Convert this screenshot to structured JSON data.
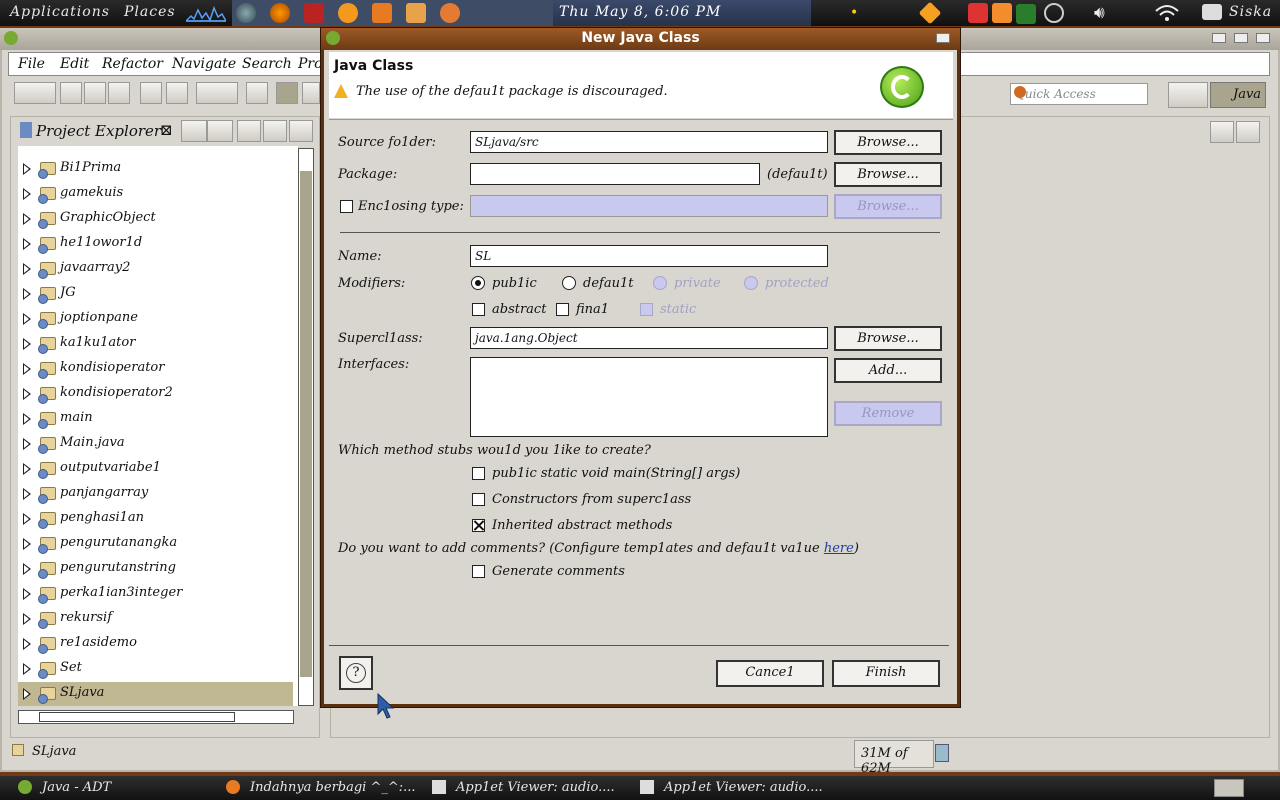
{
  "top_panel": {
    "applications": "Applications",
    "places": "Places",
    "clock": "Thu May  8,  6:06 PM",
    "user": "Siska"
  },
  "ide": {
    "menu": [
      "File",
      "Edit",
      "Refactor",
      "Navigate",
      "Search",
      "Pro"
    ],
    "quick_access_placeholder": "Quick Access",
    "perspective": "Java",
    "project_explorer_title": "Project Explorer",
    "projects": [
      "Bi1Prima",
      "gamekuis",
      "GraphicObject",
      "he11owor1d",
      "javaarray2",
      "JG",
      "joptionpane",
      "ka1ku1ator",
      "kondisioperator",
      "kondisioperator2",
      "main",
      "Main.java",
      "outputvariabe1",
      "panjangarray",
      "penghasi1an",
      "pengurutanangka",
      "pengurutanstring",
      "perka1ian3integer",
      "rekursif",
      "re1asidemo",
      "Set",
      "SLjava"
    ],
    "selected_project": "SLjava",
    "status_left": "SLjava",
    "memory": "31M of 62M"
  },
  "dialog": {
    "title": "New Java Class",
    "heading": "Java Class",
    "warning": "The use of the defau1t package is discouraged.",
    "source_folder_label": "Source fo1der:",
    "source_folder_value": "SLjava/src",
    "package_label": "Package:",
    "package_value": "",
    "package_default": "(defau1t)",
    "enclosing_label": "Enc1osing type:",
    "browse": "Browse...",
    "name_label": "Name:",
    "name_value": "SL",
    "modifiers_label": "Modifiers:",
    "mod_public": "pub1ic",
    "mod_default": "defau1t",
    "mod_private": "private",
    "mod_protected": "protected",
    "mod_abstract": "abstract",
    "mod_final": "fina1",
    "mod_static": "static",
    "superclass_label": "Supercl1ass:",
    "superclass_value": "java.1ang.Object",
    "interfaces_label": "Interfaces:",
    "add": "Add...",
    "remove": "Remove",
    "stubs_question": "Which method stubs wou1d you 1ike to create?",
    "stub_main": "pub1ic static void main(String[] args)",
    "stub_ctor": "Constructors from superc1ass",
    "stub_inherited": "Inherited abstract methods",
    "comments_question": "Do you want to add comments? (Configure temp1ates and defau1t va1ue ",
    "here_link": "here",
    "comments_question_end": ")",
    "generate_comments": "Generate comments",
    "cancel": "Cance1",
    "finish": "Finish"
  },
  "taskbar": {
    "items": [
      "Java - ADT",
      "Indahnya berbagi ^_^:...",
      "App1et Viewer: audio....",
      "App1et Viewer: audio...."
    ]
  },
  "colors": {
    "dialog_title": "#7e4419",
    "disabled_fill": "#c9c8ee",
    "selection": "#c0b892"
  }
}
